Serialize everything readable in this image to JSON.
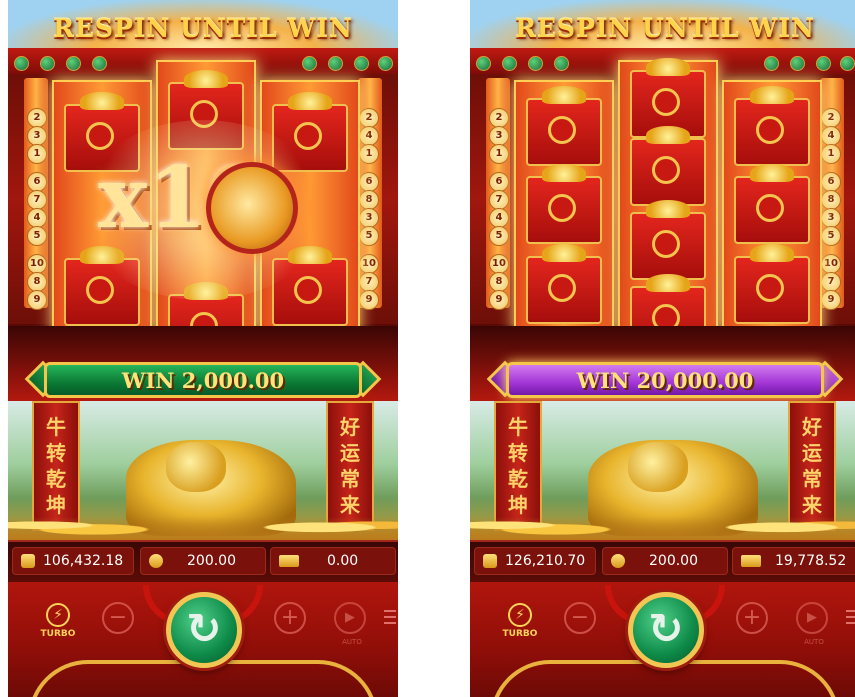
{
  "banner_title": "RESPIN UNTIL WIN",
  "line_numbers_left": [
    "2",
    "3",
    "1",
    "6",
    "7",
    "4",
    "5",
    "10",
    "8",
    "9"
  ],
  "line_numbers_right": [
    "2",
    "4",
    "1",
    "6",
    "8",
    "3",
    "5",
    "10",
    "7",
    "9"
  ],
  "pillar_left_text": [
    "牛",
    "转",
    "乾",
    "坤"
  ],
  "pillar_right_text": [
    "好",
    "运",
    "常",
    "来"
  ],
  "left_screen": {
    "multiplier": "x10",
    "win_text": "WIN 2,000.00",
    "balance": "106,432.18",
    "bet": "200.00",
    "win": "0.00",
    "win_bar_color": "#0b7a35"
  },
  "right_screen": {
    "win_text": "WIN 20,000.00",
    "balance": "126,210.70",
    "bet": "200.00",
    "win": "19,778.52",
    "win_bar_color": "#a235d6"
  },
  "controls": {
    "turbo_label": "TURBO",
    "minus": "−",
    "plus": "+",
    "auto_label": "AUTO",
    "play_glyph": "▶",
    "spin_glyph": "↻",
    "turbo_glyph": "⚡"
  },
  "icons": {
    "balance": "wallet-icon",
    "bet": "coin-stack-icon",
    "win": "win-badge-icon",
    "menu": "menu-icon"
  }
}
